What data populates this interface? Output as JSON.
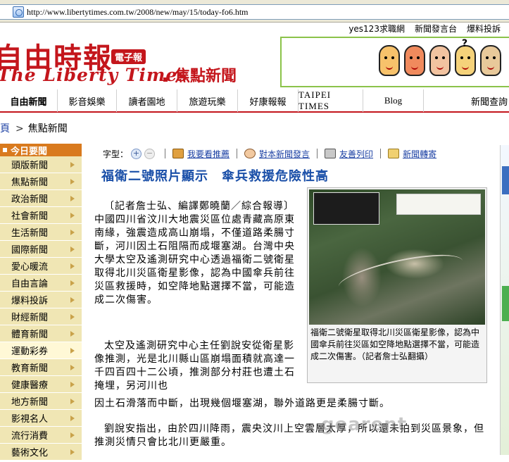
{
  "browser": {
    "url": "http://www.libertytimes.com.tw/2008/new/may/15/today-fo6.htm"
  },
  "header": {
    "top_links": [
      "yes123求職網",
      "新聞發言台",
      "爆料投訴"
    ],
    "logo_cn": "自由時報",
    "logo_badge": "電子報",
    "logo_en": "The Liberty Times",
    "section_title": "焦點新聞",
    "ad_qmark": "?"
  },
  "nav": {
    "items": [
      "自由新聞",
      "影音娛樂",
      "讀者園地",
      "旅遊玩樂",
      "好康報報",
      "TAIPEI TIMES",
      "Blog"
    ],
    "search": "新聞查詢"
  },
  "breadcrumb": {
    "home": "頁",
    "separator": ">",
    "current": "焦點新聞"
  },
  "sidebar": {
    "heading": "今日要聞",
    "items": [
      "頭版新聞",
      "焦點新聞",
      "政治新聞",
      "社會新聞",
      "生活新聞",
      "國際新聞",
      "愛心暖流",
      "自由言論",
      "爆料投訴",
      "財經新聞",
      "體育新聞",
      "運動彩券",
      "教育新聞",
      "健康醫療",
      "地方新聞",
      "影視名人",
      "流行消費",
      "藝術文化"
    ]
  },
  "toolbar": {
    "font_label": "字型：",
    "zoom_in": "+",
    "zoom_out": "−",
    "recommend": "我要看推薦",
    "report": "對本新聞發言",
    "print": "友善列印",
    "mail": "新聞轉寄"
  },
  "article": {
    "title": "福衛二號照片顯示　傘兵救援危險性高",
    "caption": "福衛二號衛星取得北川災區衛星影像，認為中國傘兵前往災區如空降地點選擇不當，可能造成二次傷害。（記者詹士弘翻攝）",
    "p1": "〔記者詹士弘、編譯鄭曉蘭／綜合報導〕中國四川省汶川大地震災區位處青藏高原東南緣，強震造成高山崩塌，不僅道路柔腸寸斷，河川因土石阻隔而成堰塞湖。台灣中央大學太空及遙測研究中心透過福衛二號衛星取得北川災區衛星影像，認為中國傘兵前往災區救援時，如空降地點選擇不當，可能造成二次傷害。",
    "p2": "太空及遙測研究中心主任劉說安從衛星影像推測，光是北川縣山區崩塌面積就高達一千四百四十二公頃，推測部分村莊也遭土石掩埋，另河川也",
    "p2_tail": "因土石滑落而中斷，出現幾個堰塞湖，聯外道路更是柔腸寸斷。",
    "p3": "劉說安指出，由於四川降雨，震央汶川上空雲層太厚，所以還未拍到災區景象，但推測災情只會比北川更嚴重。"
  },
  "watermark": "gearent"
}
